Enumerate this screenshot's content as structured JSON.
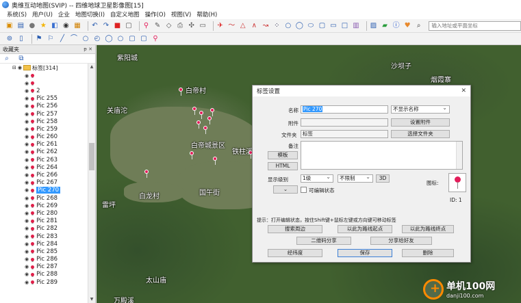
{
  "window": {
    "title": "奥维互动地图(SVIP) -- 四维地球卫星影像图[15]"
  },
  "menu": [
    "系统(S)",
    "用户(U)",
    "企业",
    "地图切换(I)",
    "自定义地图",
    "操作(O)",
    "视图(V)",
    "帮助(H)"
  ],
  "toolbar": {
    "search_placeholder": "输入地址或平面坐标"
  },
  "sidebar": {
    "title": "收藏夹",
    "controls": "ᵽ ✕",
    "root": {
      "label": "标签[314]"
    },
    "items": [
      {
        "label": ""
      },
      {
        "label": ""
      },
      {
        "label": "2"
      },
      {
        "label": "Pic 255"
      },
      {
        "label": "Pic 256"
      },
      {
        "label": "Pic 257"
      },
      {
        "label": "Pic 258"
      },
      {
        "label": "Pic 259"
      },
      {
        "label": "Pic 260"
      },
      {
        "label": "Pic 261"
      },
      {
        "label": "Pic 262"
      },
      {
        "label": "Pic 263"
      },
      {
        "label": "Pic 264"
      },
      {
        "label": "Pic 266"
      },
      {
        "label": "Pic 267"
      },
      {
        "label": "Pic 270"
      },
      {
        "label": "Pic 268"
      },
      {
        "label": "Pic 269"
      },
      {
        "label": "Pic 280"
      },
      {
        "label": "Pic 281"
      },
      {
        "label": "Pic 282"
      },
      {
        "label": "Pic 283"
      },
      {
        "label": "Pic 284"
      },
      {
        "label": "Pic 285"
      },
      {
        "label": "Pic 286"
      },
      {
        "label": "Pic 287"
      },
      {
        "label": "Pic 288"
      },
      {
        "label": "Pic 289"
      }
    ],
    "selected_index": 15
  },
  "map": {
    "labels": [
      "紫阳城",
      "沙坝子",
      "烟霞寨",
      "白帝村",
      "关庙沱",
      "白帝城景区",
      "铁柱溪",
      "白龙村",
      "国午街",
      "雷坪",
      "太山庙",
      "万殿溪"
    ]
  },
  "dialog": {
    "title": "标签设置",
    "name_label": "名称",
    "name_value": "Pic 270",
    "name_display_option": "不显示名称",
    "attachment_label": "附件",
    "attachment_button": "设置附件",
    "folder_label": "文件夹",
    "folder_value": "标签",
    "folder_button": "选择文件夹",
    "note_label": "备注",
    "template_button": "模板",
    "html_button": "HTML",
    "display_level_label": "显示级别",
    "display_level_value": "1级",
    "limit_value": "不限制",
    "three_d_button": "3D",
    "checkbox_label": "可编辑状态",
    "icon_label": "图标:",
    "id_label": "ID: 1",
    "hint": "提示：打开编辑状态，按住Shift键+鼠标左键或方向键可移动标签",
    "buttons": {
      "search_nearby": "搜索周边",
      "as_start": "以此为路线起点",
      "as_end": "以此为路线终点",
      "qr_share": "二维码分享",
      "share_friend": "分享给好友",
      "coordinates": "经纬度",
      "save": "保存",
      "delete": "删除"
    }
  },
  "watermark": {
    "main": "单机100网",
    "sub": "danji100.com"
  }
}
